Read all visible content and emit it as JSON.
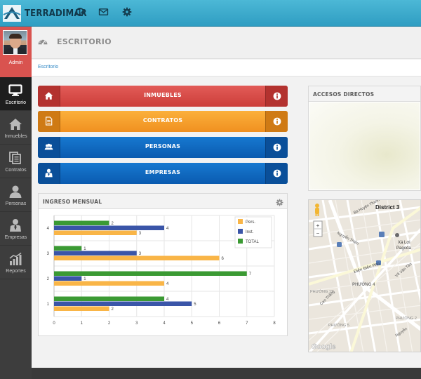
{
  "app": {
    "brand": "TERRADIMAR"
  },
  "topbar": {
    "icons": [
      "globe-icon",
      "envelope-icon",
      "gear-icon"
    ]
  },
  "user": {
    "name": "Admin"
  },
  "sidebar": {
    "items": [
      {
        "label": "Escritorio",
        "icon": "monitor-icon",
        "active": true
      },
      {
        "label": "Inmuebles",
        "icon": "home-icon"
      },
      {
        "label": "Contratos",
        "icon": "documents-icon"
      },
      {
        "label": "Personas",
        "icon": "user-icon"
      },
      {
        "label": "Empresas",
        "icon": "businessman-icon"
      },
      {
        "label": "Reportes",
        "icon": "bar-chart-icon"
      }
    ]
  },
  "header": {
    "title": "ESCRITORIO",
    "icon": "dashboard-icon"
  },
  "breadcrumb": {
    "current": "Escritorio"
  },
  "actions": [
    {
      "label": "INMUEBLES",
      "color": "#d9534f",
      "icon": "home-icon"
    },
    {
      "label": "CONTRATOS",
      "color": "#f7a531",
      "icon": "document-icon"
    },
    {
      "label": "PERSONAS",
      "color": "#0c67c0",
      "icon": "users-icon"
    },
    {
      "label": "EMPRESAS",
      "color": "#0c67c0",
      "icon": "businessman-icon"
    }
  ],
  "accesos": {
    "title": "ACCESOS DIRECTOS"
  },
  "chart_widget": {
    "title": "INGRESO MENSUAL"
  },
  "chart_data": {
    "type": "bar",
    "orientation": "horizontal",
    "categories": [
      "1",
      "2",
      "3",
      "4"
    ],
    "series": [
      {
        "name": "Pers.",
        "color": "#f9b547",
        "values": [
          2,
          4,
          6,
          3
        ]
      },
      {
        "name": "Inst.",
        "color": "#3a55a8",
        "values": [
          5,
          1,
          3,
          4
        ]
      },
      {
        "name": "TOTAL",
        "color": "#3b9a33",
        "values": [
          4,
          7,
          1,
          2
        ]
      }
    ],
    "xlim": [
      0,
      8
    ],
    "xticks": [
      "0",
      "1",
      "2",
      "3",
      "4",
      "5",
      "6",
      "7",
      "8"
    ],
    "grid": true,
    "legend": "top-right"
  },
  "map": {
    "labels": {
      "district": "District 3",
      "pagoda_1": "Xá Lợi",
      "pagoda_2": "Pagoda",
      "phuong_4": "PHƯỜNG 4",
      "phuong_12": "PHƯỜNG 12",
      "phuong_5": "PHƯỜNG 5",
      "phuong_2": "PHƯỜNG 2",
      "street_nguyen_thien": "Nguyễn Thiện",
      "street_ba_huyen": "Bà Huyện Thanh Quan",
      "street_dien_bien": "Điện Biên Phủ",
      "street_vo_van_tan": "Võ Văn Tần",
      "street_cao_thang": "Cao Thắng",
      "street_nguyen": "Nguyễn",
      "google": "Google"
    },
    "zoom_in": "+",
    "zoom_out": "−"
  }
}
